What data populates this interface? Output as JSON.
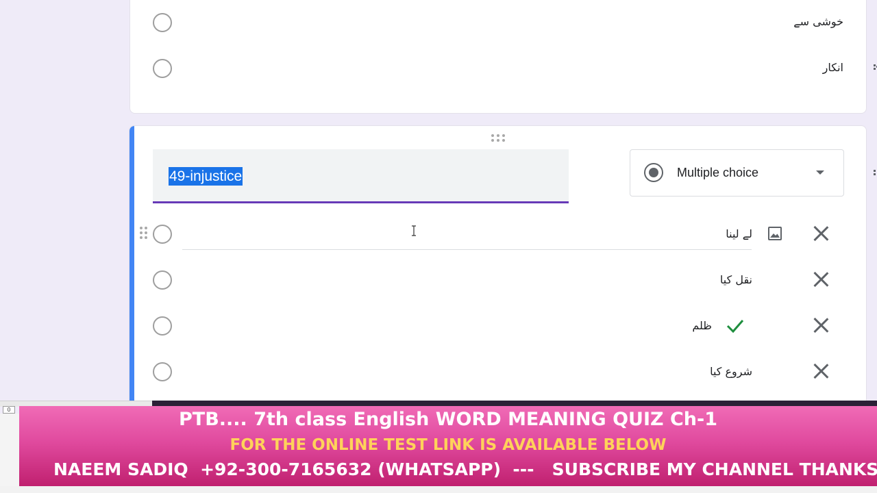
{
  "previous_question": {
    "options": [
      {
        "label": "خوشی سے"
      },
      {
        "label": "انکار"
      }
    ]
  },
  "question": {
    "title": "49-injustice",
    "type_label": "Multiple choice",
    "options": [
      {
        "label": "لے لینا",
        "correct": false
      },
      {
        "label": "نقل کیا",
        "correct": false
      },
      {
        "label": "ظلم",
        "correct": true
      },
      {
        "label": "شروع کیا",
        "correct": false
      }
    ]
  },
  "overlay": {
    "counter": "0",
    "line1": "PTB.... 7th class English WORD MEANING QUIZ Ch-1",
    "line2": "FOR THE ONLINE TEST LINK IS AVAILABLE BELOW",
    "line3": "NAEEM SADIQ  +92-300-7165632 (WHATSAPP)  ---   SUBSCRIBE MY CHANNEL THANKS"
  },
  "colors": {
    "accent_left": "#4285f4",
    "title_underline": "#673ab7",
    "selection": "#1a73e8",
    "correct_check": "#1e8e3e",
    "banner_pink": "#e04a9e",
    "banner_yellow": "#ffd25a"
  },
  "icons": [
    "drag-handle-icon",
    "image-icon",
    "close-icon",
    "check-icon",
    "text-cursor-icon",
    "dropdown-arrow-icon"
  ]
}
